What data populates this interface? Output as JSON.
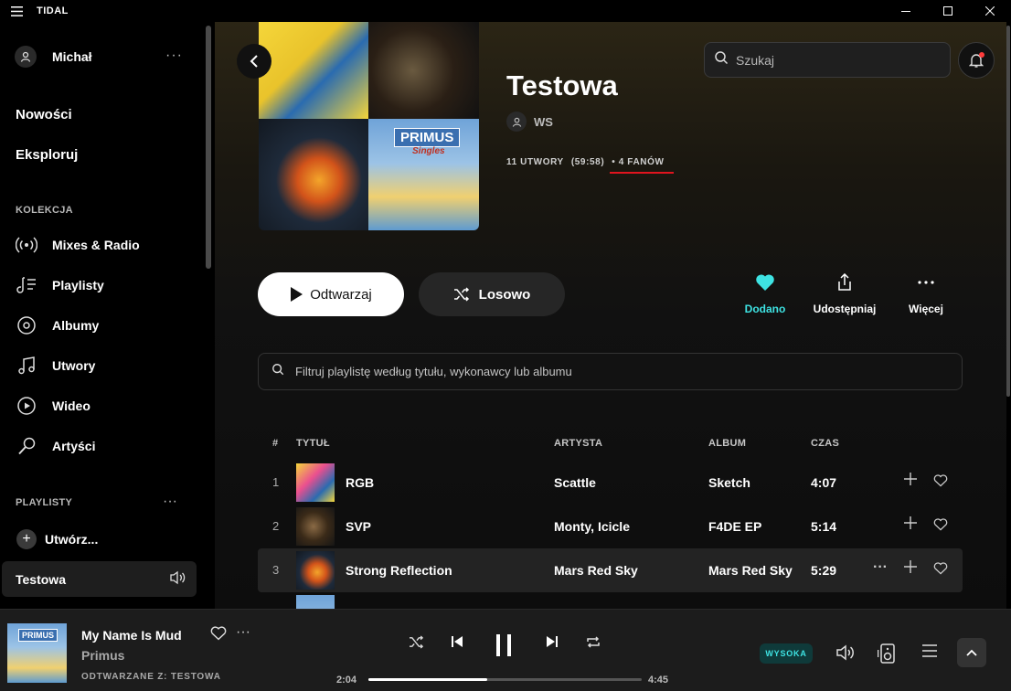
{
  "app": {
    "title": "TIDAL"
  },
  "user": {
    "name": "Michał",
    "menu": "···"
  },
  "nav": {
    "news": "Nowości",
    "explore": "Eksploruj"
  },
  "collection": {
    "label": "KOLEKCJA",
    "items": [
      {
        "label": "Mixes & Radio",
        "icon": "radio-icon"
      },
      {
        "label": "Playlisty",
        "icon": "playlist-icon"
      },
      {
        "label": "Albumy",
        "icon": "album-icon"
      },
      {
        "label": "Utwory",
        "icon": "music-note-icon"
      },
      {
        "label": "Wideo",
        "icon": "video-icon"
      },
      {
        "label": "Artyści",
        "icon": "microphone-icon"
      }
    ]
  },
  "playlists_section": {
    "label": "PLAYLISTY",
    "menu": "···",
    "create": "Utwórz...",
    "active": "Testowa"
  },
  "header": {
    "search_placeholder": "Szukaj"
  },
  "playlist": {
    "title": "Testowa",
    "creator": "WS",
    "tracks_count": "11 UTWORY",
    "duration": "(59:58)",
    "fans": "• 4 FANÓW",
    "play_label": "Odtwarzaj",
    "shuffle_label": "Losowo",
    "actions": {
      "added": "Dodano",
      "share": "Udostępniaj",
      "more": "Więcej"
    },
    "filter_placeholder": "Filtruj playlistę według tytułu, wykonawcy lub albumu",
    "cover_text": {
      "band": "PRIMUS",
      "singles": "Singles"
    }
  },
  "table": {
    "headers": {
      "num": "#",
      "title": "TYTUŁ",
      "artist": "ARTYSTA",
      "album": "ALBUM",
      "time": "CZAS"
    },
    "rows": [
      {
        "num": "1",
        "title": "RGB",
        "artist": "Scattle",
        "album": "Sketch",
        "time": "4:07"
      },
      {
        "num": "2",
        "title": "SVP",
        "artist": "Monty, Icicle",
        "album": "F4DE EP",
        "time": "5:14"
      },
      {
        "num": "3",
        "title": "Strong Reflection",
        "artist": "Mars Red Sky",
        "album": "Mars Red Sky",
        "time": "5:29"
      }
    ]
  },
  "player": {
    "title": "My Name Is Mud",
    "artist": "Primus",
    "playing_from": "ODTWARZANE Z: TESTOWA",
    "elapsed": "2:04",
    "total": "4:45",
    "progress": 0.435,
    "quality": "WYSOKA",
    "art_text": "PRIMUS"
  },
  "colors": {
    "accent": "#3ee3e3",
    "highlight_underline": "#e0141e",
    "notification_dot": "#ff3b3b"
  }
}
